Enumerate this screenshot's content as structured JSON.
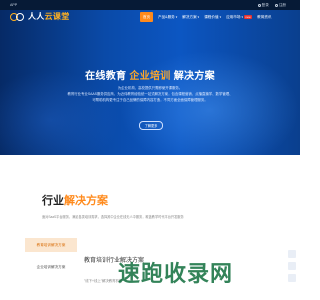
{
  "topbar": {
    "app_label": "APP",
    "login": "登录",
    "register": "注册"
  },
  "logo": {
    "text_a": "人人",
    "text_b": "云课堂"
  },
  "nav": {
    "home": "首页",
    "items": [
      {
        "label": "产品&服务"
      },
      {
        "label": "解决方案"
      },
      {
        "label": "课程价值"
      },
      {
        "label": "应用市场",
        "badge": "new"
      },
      {
        "label": "教育资讯"
      }
    ]
  },
  "hero": {
    "title_a": "在线教育",
    "title_hl": "企业培训",
    "title_b": "解决方案",
    "lines": [
      "为企业机构、高校提供只需即使开课服务。",
      "教育行业专业SAAS服务供应商，为近伟教育经验统一站式解决方案，包含课程营销、点播直播学、数学管理、",
      "可帮助机构更专注于自己品牌的保障内容打造，不同方面全面保障管理服务。"
    ],
    "button": "了解更多"
  },
  "section": {
    "title_a": "行业",
    "title_hl": "解决方案",
    "desc": "面对SaaS平台服务，满足各类培训需求，选择其中企业在线无人中服务，覆盖教学时代平台开发服务"
  },
  "tabs": [
    {
      "label": "教育培训解决方案",
      "active": true
    },
    {
      "label": "企业培训解决方案",
      "active": false
    }
  ],
  "panel": {
    "title": "教育培训行业解决方案",
    "text": "\"线下+线上\"解决教育机构"
  },
  "watermark": "速跑收录网"
}
